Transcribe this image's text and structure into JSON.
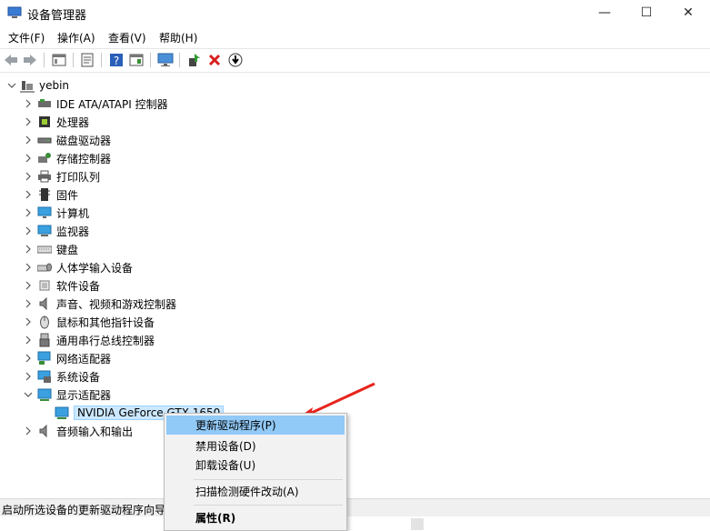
{
  "window": {
    "title": "设备管理器",
    "min_glyph": "—",
    "max_glyph": "☐",
    "close_glyph": "✕"
  },
  "menu": [
    "文件(F)",
    "操作(A)",
    "查看(V)",
    "帮助(H)"
  ],
  "tree": {
    "root": "yebin",
    "categories": [
      {
        "label": "IDE ATA/ATAPI 控制器",
        "icon": "ide-controller-icon"
      },
      {
        "label": "处理器",
        "icon": "processor-icon"
      },
      {
        "label": "磁盘驱动器",
        "icon": "disk-drive-icon"
      },
      {
        "label": "存储控制器",
        "icon": "storage-controller-icon"
      },
      {
        "label": "打印队列",
        "icon": "printer-icon"
      },
      {
        "label": "固件",
        "icon": "firmware-icon"
      },
      {
        "label": "计算机",
        "icon": "computer-icon"
      },
      {
        "label": "监视器",
        "icon": "monitor-icon"
      },
      {
        "label": "键盘",
        "icon": "keyboard-icon"
      },
      {
        "label": "人体学输入设备",
        "icon": "hid-icon"
      },
      {
        "label": "软件设备",
        "icon": "software-device-icon"
      },
      {
        "label": "声音、视频和游戏控制器",
        "icon": "speaker-icon"
      },
      {
        "label": "鼠标和其他指针设备",
        "icon": "mouse-icon"
      },
      {
        "label": "通用串行总线控制器",
        "icon": "usb-icon"
      },
      {
        "label": "网络适配器",
        "icon": "network-adapter-icon"
      },
      {
        "label": "系统设备",
        "icon": "system-device-icon"
      },
      {
        "label": "显示适配器",
        "icon": "display-adapter-icon"
      }
    ],
    "selected_device": "NVIDIA GeForce GTX 1650",
    "after": {
      "label": "音频输入和输出",
      "icon": "audio-io-icon"
    }
  },
  "context_menu": {
    "update_driver": "更新驱动程序(P)",
    "disable_device": "禁用设备(D)",
    "uninstall_device": "卸载设备(U)",
    "scan_hardware": "扫描检测硬件改动(A)",
    "properties": "属性(R)"
  },
  "status": "启动所选设备的更新驱动程序向导"
}
